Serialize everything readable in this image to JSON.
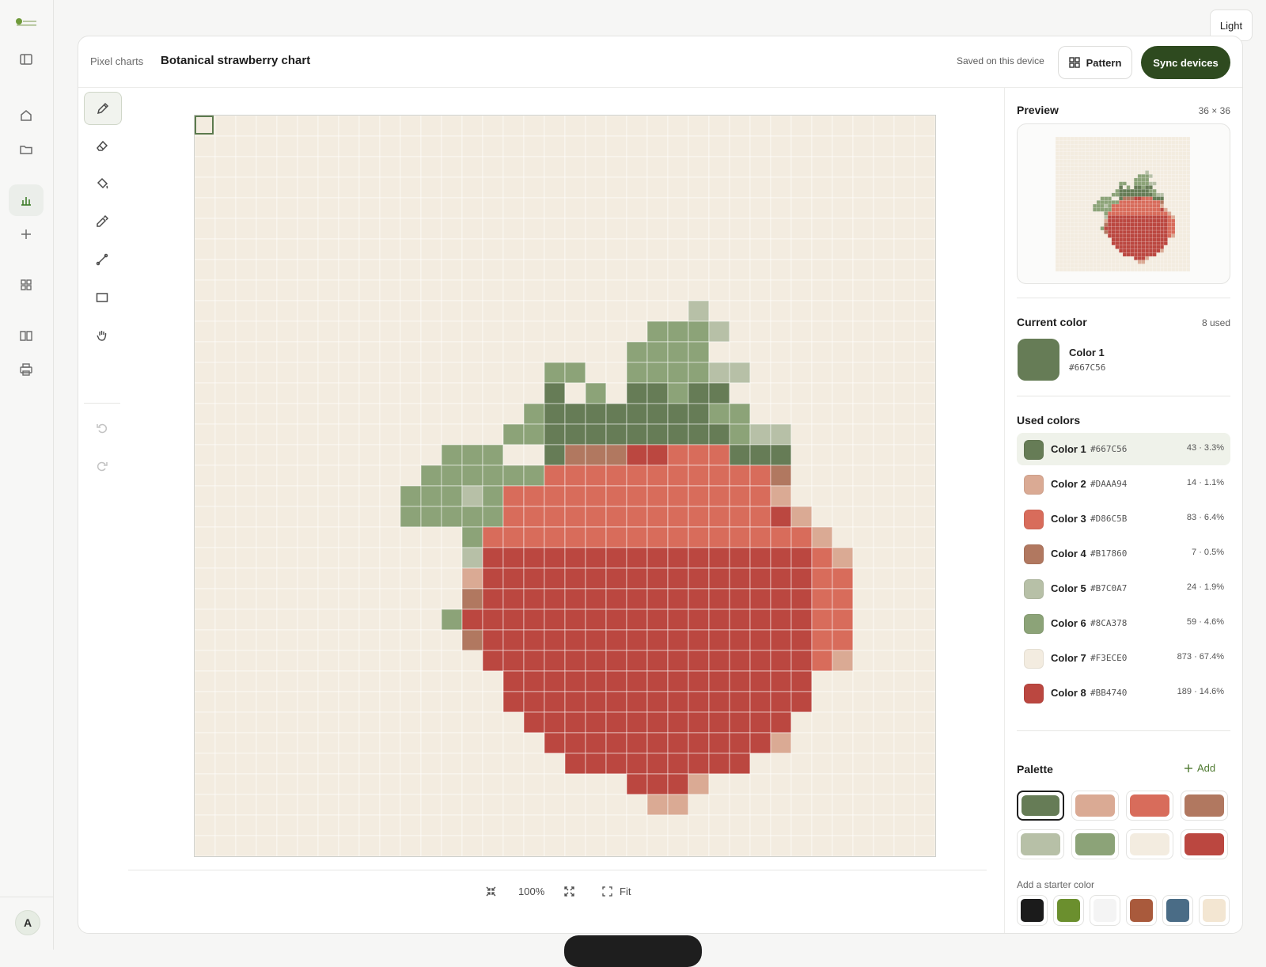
{
  "theme_toggle": "Light",
  "header": {
    "breadcrumb": "Pixel charts",
    "title": "Botanical strawberry chart",
    "saved_status": "Saved on this device",
    "pattern_label": "Pattern",
    "sync_label": "Sync devices"
  },
  "icons": {
    "rail": [
      "logo",
      "sidebar-toggle-icon",
      "home-icon",
      "folder-icon",
      "chart-icon",
      "plus-icon",
      "grid-icon",
      "book-icon",
      "printer-icon"
    ],
    "tools": [
      "pencil-icon",
      "eraser-icon",
      "fill-bucket-icon",
      "eyedropper-icon",
      "line-icon",
      "rectangle-icon",
      "hand-icon",
      "undo-icon",
      "redo-icon"
    ]
  },
  "user": {
    "avatar_initial": "A"
  },
  "zoom": {
    "level": "100%",
    "fit_label": "Fit"
  },
  "preview": {
    "title": "Preview",
    "size": "36 × 36"
  },
  "current_color": {
    "title": "Current color",
    "used_count": "8 used",
    "name": "Color 1",
    "hex": "#667C56",
    "color": "#667C56"
  },
  "used_colors": {
    "title": "Used colors",
    "items": [
      {
        "name": "Color 1",
        "hex": "#667C56",
        "stats": "43 · 3.3%",
        "color": "#667C56"
      },
      {
        "name": "Color 2",
        "hex": "#DAAA94",
        "stats": "14 · 1.1%",
        "color": "#DAAA94"
      },
      {
        "name": "Color 3",
        "hex": "#D86C5B",
        "stats": "83 · 6.4%",
        "color": "#D86C5B"
      },
      {
        "name": "Color 4",
        "hex": "#B17860",
        "stats": "7 · 0.5%",
        "color": "#B17860"
      },
      {
        "name": "Color 5",
        "hex": "#B7C0A7",
        "stats": "24 · 1.9%",
        "color": "#B7C0A7"
      },
      {
        "name": "Color 6",
        "hex": "#8CA378",
        "stats": "59 · 4.6%",
        "color": "#8CA378"
      },
      {
        "name": "Color 7",
        "hex": "#F3ECE0",
        "stats": "873 · 67.4%",
        "color": "#F3ECE0"
      },
      {
        "name": "Color 8",
        "hex": "#BB4740",
        "stats": "189 · 14.6%",
        "color": "#BB4740"
      }
    ]
  },
  "palette": {
    "title": "Palette",
    "add_label": "Add",
    "swatches": [
      "#667C56",
      "#DAAA94",
      "#D86C5B",
      "#B17860",
      "#B7C0A7",
      "#8CA378",
      "#F3ECE0",
      "#BB4740"
    ]
  },
  "starter": {
    "label": "Add a starter color",
    "swatches": [
      "#1b1b1b",
      "#6b8f2e",
      "#f4f4f4",
      "#a95a3c",
      "#4a6c86",
      "#f3e6d2"
    ]
  },
  "pixel_grid": {
    "size": "36 × 36",
    "legend": {
      "1": "#667C56",
      "2": "#DAAA94",
      "3": "#D86C5B",
      "4": "#B17860",
      "5": "#B7C0A7",
      "6": "#8CA378",
      "7": "#F3ECE0",
      "8": "#BB4740"
    },
    "rows": [
      "777777777777777777777777777777777777",
      "777777777777777777777777777777777777",
      "777777777777777777777777777777777777",
      "777777777777777777777777777777777777",
      "777777777777777777777777777777777777",
      "777777777777777777777777777777777777",
      "777777777777777777777777777777777777",
      "777777777777777777777777777777777777",
      "777777777777777777777777777777777777",
      "777777777777777777777777577777777777",
      "777777777777777777777766657777777777",
      "777777777777777777777666677777777777",
      "777777777777777776677666655777777777",
      "777777777777777771767116117777777777",
      "777777777777777761111111166777777777",
      "777777777777777661111111116557777777",
      "777777777777666771444883331117777777",
      "777777777776666663333333333347777777",
      "777777777766656333333333333327777777",
      "777777777766666333333333333382777777",
      "777777777777763333333333333333277777",
      "777777777777758888888888888888327777",
      "777777777777728888888888888888337777",
      "777777777777748888888888888888337777",
      "777777777777688888888888888888337777",
      "777777777777748888888888888888337777",
      "777777777777778888888888888888327777",
      "777777777777777888888888888888777777",
      "777777777777777888888888888888777777",
      "777777777777777788888888888887777777",
      "777777777777777778888888888827777777",
      "777777777777777777888888888777777777",
      "777777777777777777777888277777777777",
      "777777777777777777777722777777777777",
      "777777777777777777777777777777777777",
      "777777777777777777777777777777777777"
    ]
  }
}
